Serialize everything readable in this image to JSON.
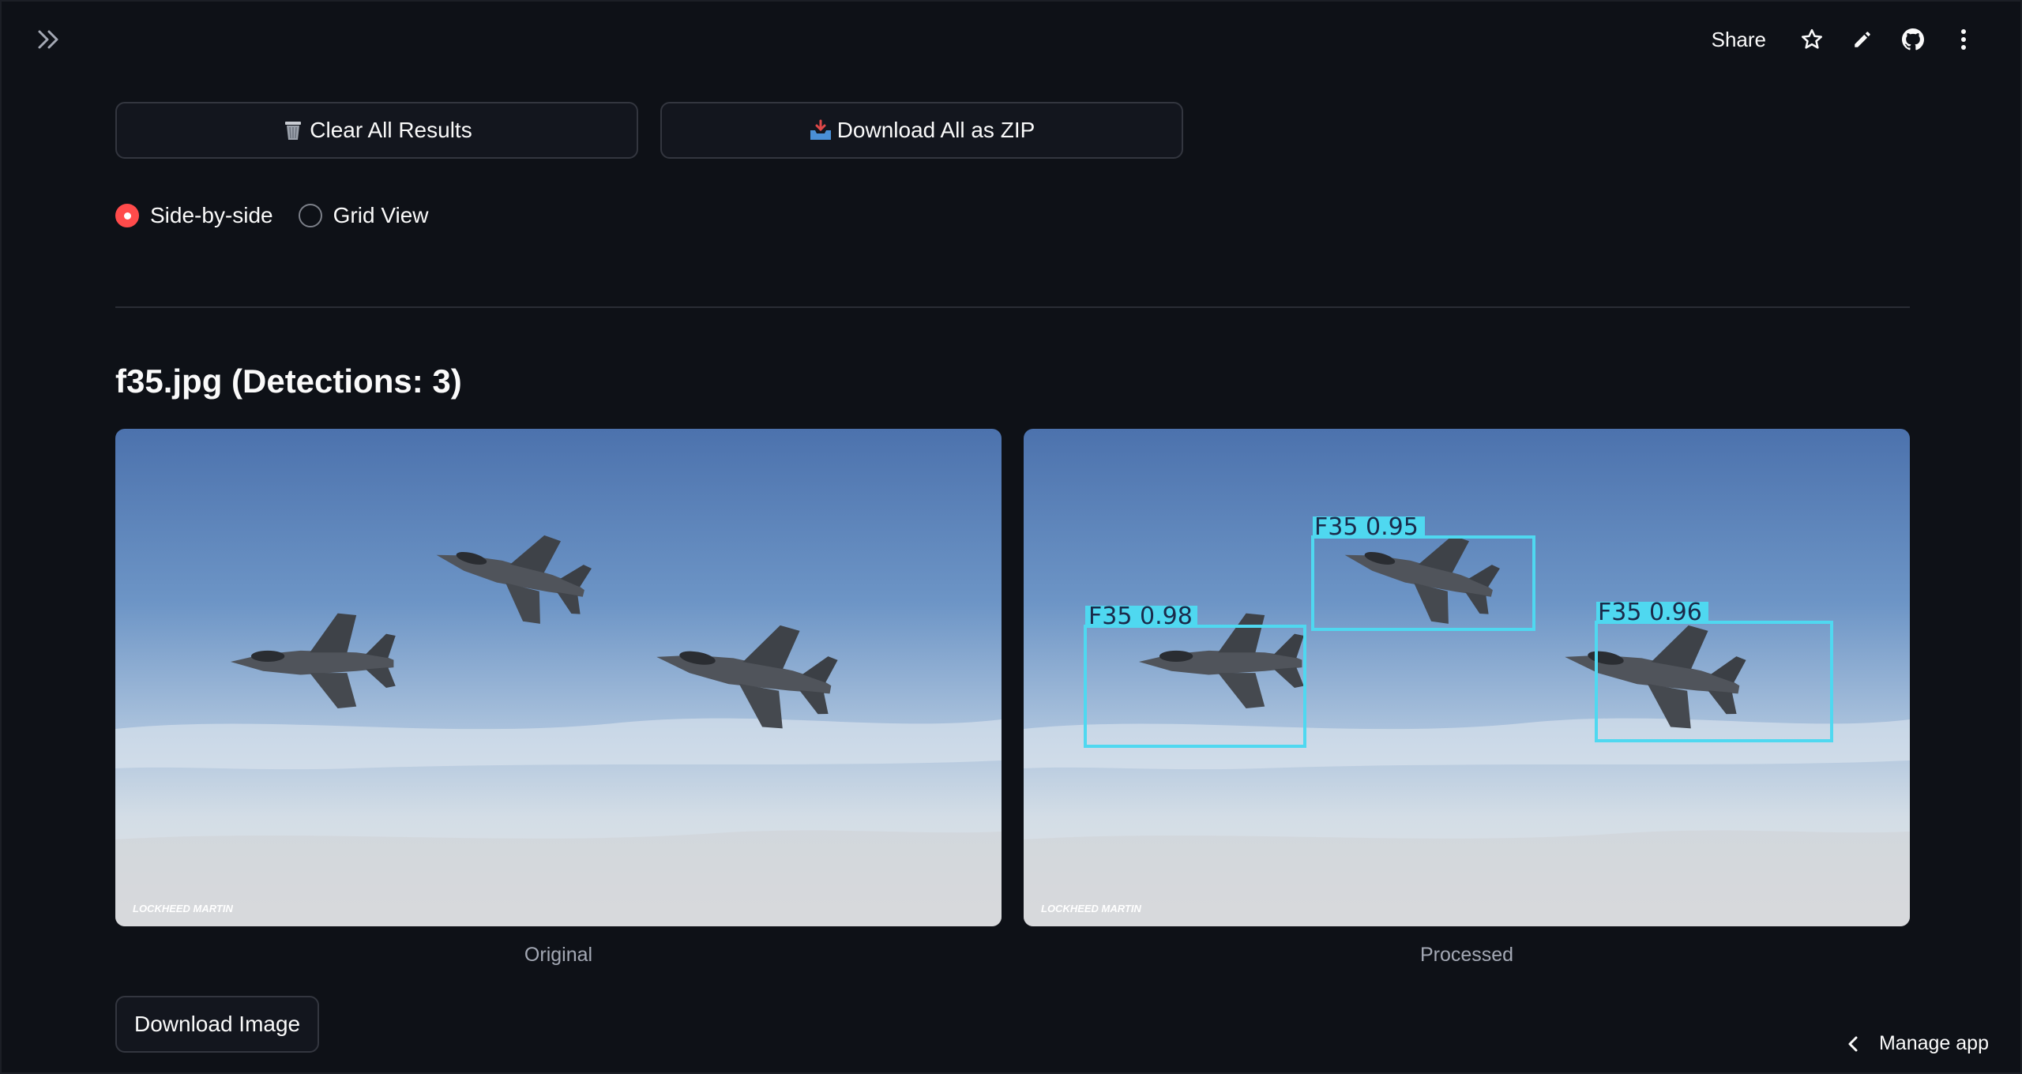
{
  "header": {
    "share_label": "Share",
    "icons": [
      "expand-sidebar-icon",
      "star-icon",
      "edit-icon",
      "github-icon",
      "more-vert-icon"
    ]
  },
  "actions": {
    "clear_label": "Clear All Results",
    "clear_icon": "wastebasket-icon",
    "zip_label": "Download All as ZIP",
    "zip_icon": "inbox-tray-icon"
  },
  "view_mode": {
    "options": [
      "Side-by-side",
      "Grid View"
    ],
    "selected": "Side-by-side"
  },
  "result": {
    "title": "f35.jpg (Detections: 3)",
    "original_caption": "Original",
    "processed_caption": "Processed",
    "watermark": "LOCKHEED MARTIN",
    "detections": [
      {
        "label": "F35",
        "confidence": "0.98"
      },
      {
        "label": "F35",
        "confidence": "0.95"
      },
      {
        "label": "F35",
        "confidence": "0.96"
      }
    ],
    "download_label": "Download Image"
  },
  "footer": {
    "manage_label": "Manage app"
  },
  "colors": {
    "background": "#0e1117",
    "accent": "#ff4b4b",
    "box": "#4fd8f0"
  }
}
